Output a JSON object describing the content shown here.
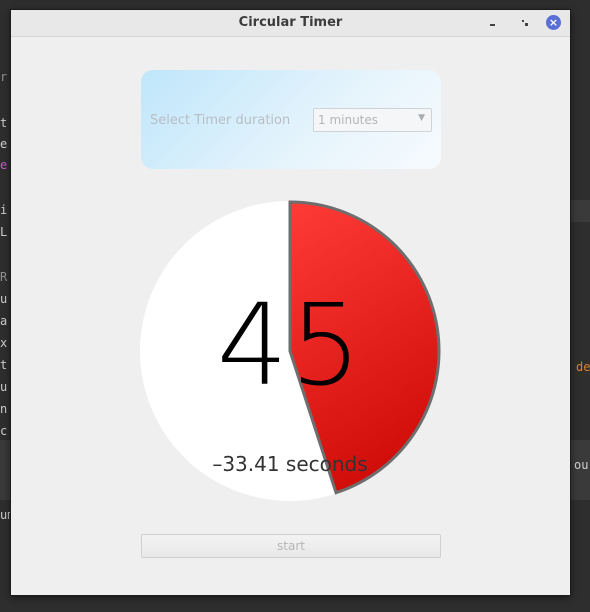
{
  "window": {
    "title": "Circular Timer"
  },
  "controls": {
    "label": "Select Timer duration",
    "duration_options": [
      "1 minutes"
    ],
    "selected_duration": "1 minutes"
  },
  "timer": {
    "count": "45",
    "elapsed_text": "–33.41 seconds",
    "progress_fraction": 0.45,
    "fill_color": "#e8140f",
    "outline_color": "#6e6e6e"
  },
  "actions": {
    "start_label": "start"
  },
  "background": {
    "left_fragments": [
      "r",
      "t",
      "e",
      "e",
      "i",
      "L",
      "R",
      "u",
      "a",
      "x",
      "t",
      "u",
      "n",
      "c",
      "um"
    ],
    "right_fragments": [
      "de",
      "ou"
    ]
  },
  "icons": {
    "minimize": "minimize-icon",
    "maximize": "maximize-icon",
    "close": "close-icon"
  }
}
